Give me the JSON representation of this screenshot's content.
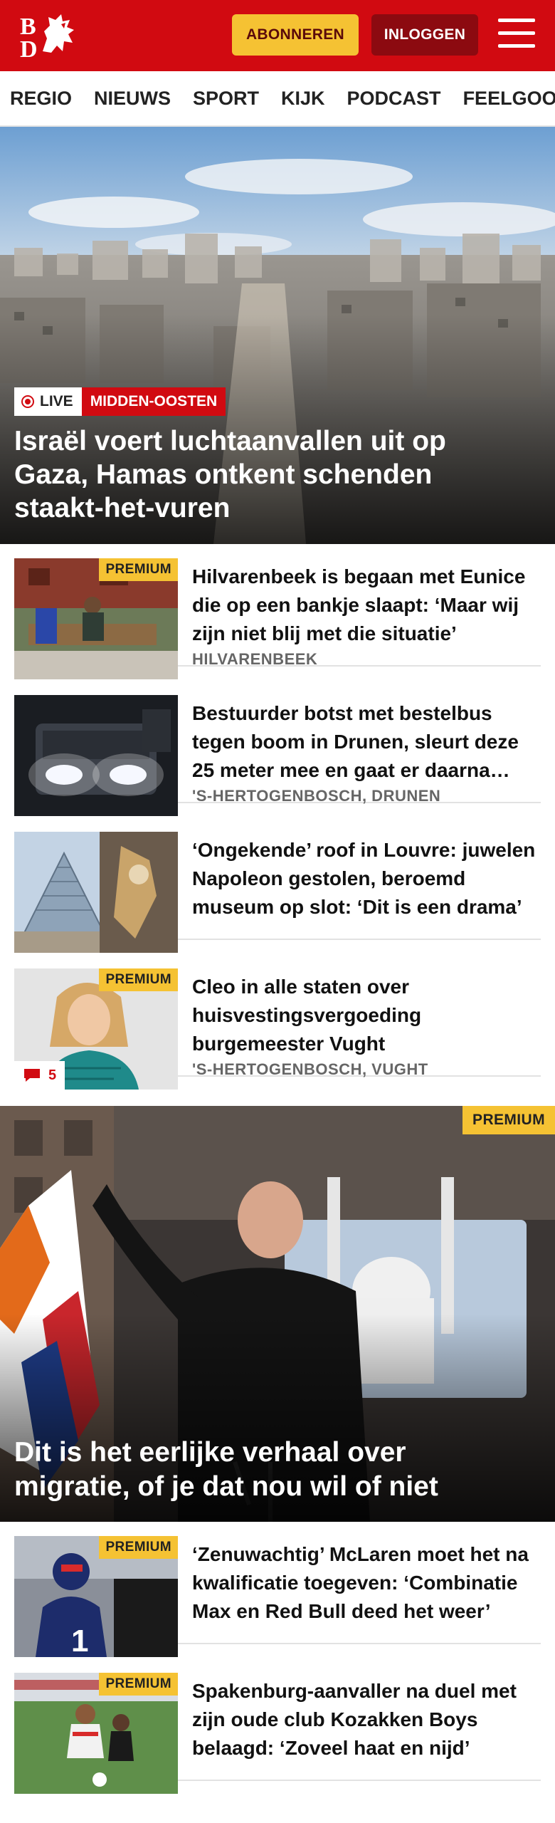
{
  "header": {
    "logo": "BD",
    "subscribe_label": "ABONNEREN",
    "login_label": "INLOGGEN"
  },
  "nav": {
    "items": [
      "REGIO",
      "NIEUWS",
      "SPORT",
      "KIJK",
      "PODCAST",
      "FEELGOOD"
    ]
  },
  "lead": {
    "live_label": "LIVE",
    "topic_label": "MIDDEN-OOSTEN",
    "title": "Israël voert luchtaanvallen uit op Gaza, Hamas ontkent schenden staakt-het-vuren"
  },
  "articles": [
    {
      "premium": "PREMIUM",
      "title": "Hilvarenbeek is begaan met Eunice die op een bankje slaapt: ‘Maar wij zijn niet blij met die situatie’",
      "location": "HILVARENBEEK"
    },
    {
      "title": "Bestuurder botst met bestelbus tegen boom in Drunen, sleurt deze 25 meter mee en gaat er daarna vandoor",
      "location": "'S-HERTOGENBOSCH, DRUNEN"
    },
    {
      "title": "‘Ongekende’ roof in Louvre: juwelen Napoleon gestolen, beroemd museum op slot: ‘Dit is een drama’",
      "location": ""
    },
    {
      "premium": "PREMIUM",
      "title": "Cleo in alle staten over huisvestingsvergoeding burgemeester Vught",
      "location": "'S-HERTOGENBOSCH, VUGHT",
      "comments": "5"
    }
  ],
  "feature": {
    "premium": "PREMIUM",
    "title": "Dit is het eerlijke verhaal over migratie, of je dat nou wil of niet"
  },
  "sports": [
    {
      "premium": "PREMIUM",
      "title": "‘Zenuwachtig’ McLaren moet het na kwalificatie toegeven: ‘Combinatie Max en Red Bull deed het weer’"
    },
    {
      "premium": "PREMIUM",
      "title": "Spakenburg-aanvaller na duel met zijn oude club Kozakken Boys belaagd: ‘Zoveel haat en nijd’"
    }
  ],
  "colors": {
    "brand_red": "#d10a11",
    "premium_yellow": "#f5c233"
  }
}
